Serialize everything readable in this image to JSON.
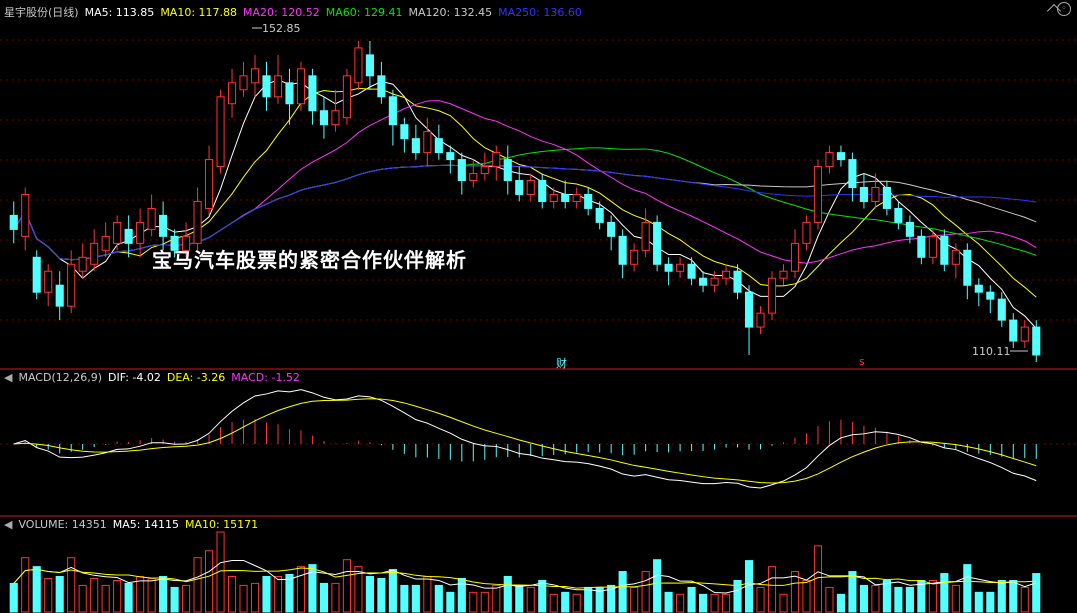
{
  "header": {
    "title": "星宇股份(日线)",
    "ma5": "MA5: 113.85",
    "ma10": "MA10: 117.88",
    "ma20": "MA20: 120.52",
    "ma60": "MA60: 129.41",
    "ma120": "MA120: 132.45",
    "ma250": "MA250: 136.60"
  },
  "overlay_text": "宝马汽车股票的紧密合作伙伴解析",
  "markers": {
    "high_label": "152.85",
    "low_label": "110.11",
    "fin_badge": "财",
    "s_badge": "s"
  },
  "macd_legend": {
    "name": "MACD(12,26,9)",
    "dif": "DIF: -4.02",
    "dea": "DEA: -3.26",
    "macd": "MACD: -1.52"
  },
  "volume_legend": {
    "name": "VOLUME: 14351",
    "ma5": "MA5: 14115",
    "ma10": "MA10: 15171"
  },
  "colors": {
    "up": "#ff3232",
    "down": "#54ffff",
    "ma5": "#ffffff",
    "ma10": "#ffff00",
    "ma20": "#ff32ff",
    "ma60": "#00e600",
    "ma120": "#c8c8c8",
    "ma250": "#3232ff",
    "divider": "#c81e1e"
  },
  "chart_data": [
    {
      "type": "candlestick",
      "title": "星宇股份(日线)",
      "ylim": [
        108,
        156
      ],
      "candles": [
        [
          128,
          126,
          130,
          124
        ],
        [
          125,
          131,
          132,
          123
        ],
        [
          122,
          117,
          123,
          116
        ],
        [
          117,
          120,
          121,
          115
        ],
        [
          118,
          115,
          120,
          113
        ],
        [
          115,
          121,
          123,
          114
        ],
        [
          120,
          122,
          124,
          119
        ],
        [
          121,
          124,
          126,
          120
        ],
        [
          123,
          125,
          127,
          122
        ],
        [
          124,
          127,
          128,
          123
        ],
        [
          126,
          124,
          128,
          122
        ],
        [
          124,
          127,
          129,
          122
        ],
        [
          126,
          129,
          131,
          125
        ],
        [
          128,
          125,
          130,
          123
        ],
        [
          125,
          123,
          126,
          122
        ],
        [
          123,
          125,
          127,
          122
        ],
        [
          124,
          130,
          132,
          123
        ],
        [
          129,
          136,
          138,
          128
        ],
        [
          135,
          145,
          146,
          134
        ],
        [
          144,
          147,
          149,
          142
        ],
        [
          146,
          148,
          150,
          145
        ],
        [
          147,
          149,
          151,
          145
        ],
        [
          148,
          145,
          150,
          143
        ],
        [
          145,
          148,
          151,
          144
        ],
        [
          147,
          144,
          149,
          141
        ],
        [
          144,
          149,
          150,
          143
        ],
        [
          148,
          143,
          149,
          141
        ],
        [
          143,
          141,
          145,
          139
        ],
        [
          141,
          143,
          146,
          140
        ],
        [
          142,
          148,
          149,
          141
        ],
        [
          147,
          152,
          153,
          146
        ],
        [
          151,
          148,
          153,
          146
        ],
        [
          148,
          145,
          150,
          144
        ],
        [
          145,
          141,
          146,
          138
        ],
        [
          141,
          139,
          142,
          137
        ],
        [
          139,
          137,
          141,
          136
        ],
        [
          137,
          140,
          142,
          135
        ],
        [
          139,
          137,
          141,
          136
        ],
        [
          137,
          136,
          138,
          134
        ],
        [
          136,
          133,
          137,
          131
        ],
        [
          133,
          134,
          136,
          132
        ],
        [
          134,
          135,
          137,
          133
        ],
        [
          135,
          137,
          138,
          133
        ],
        [
          136,
          133,
          138,
          131
        ],
        [
          133,
          131,
          135,
          130
        ],
        [
          131,
          133,
          134,
          130
        ],
        [
          133,
          130,
          134,
          129
        ],
        [
          130,
          131,
          132,
          129
        ],
        [
          131,
          130,
          133,
          129
        ],
        [
          130,
          131,
          132,
          129
        ],
        [
          131,
          129,
          132,
          128
        ],
        [
          129,
          127,
          130,
          126
        ],
        [
          127,
          125,
          128,
          123
        ],
        [
          125,
          121,
          126,
          119
        ],
        [
          121,
          123,
          124,
          120
        ],
        [
          123,
          127,
          129,
          122
        ],
        [
          127,
          121,
          128,
          120
        ],
        [
          121,
          120,
          122,
          118
        ],
        [
          120,
          121,
          122,
          119
        ],
        [
          121,
          119,
          122,
          118
        ],
        [
          119,
          118,
          120,
          117
        ],
        [
          118,
          119,
          120,
          117
        ],
        [
          119,
          120,
          121,
          118
        ],
        [
          120,
          117,
          121,
          116
        ],
        [
          117,
          112,
          118,
          108
        ],
        [
          112,
          114,
          115,
          111
        ],
        [
          114,
          119,
          120,
          113
        ],
        [
          119,
          120,
          121,
          118
        ],
        [
          120,
          124,
          126,
          119
        ],
        [
          124,
          127,
          128,
          123
        ],
        [
          127,
          135,
          136,
          126
        ],
        [
          135,
          137,
          138,
          134
        ],
        [
          137,
          136,
          138,
          135
        ],
        [
          136,
          132,
          137,
          130
        ],
        [
          132,
          130,
          134,
          129
        ],
        [
          130,
          132,
          134,
          129
        ],
        [
          132,
          129,
          133,
          128
        ],
        [
          129,
          127,
          130,
          126
        ],
        [
          127,
          125,
          128,
          124
        ],
        [
          125,
          122,
          126,
          121
        ],
        [
          122,
          125,
          126,
          121
        ],
        [
          125,
          121,
          126,
          120
        ],
        [
          121,
          123,
          124,
          119
        ],
        [
          123,
          118,
          124,
          116
        ],
        [
          118,
          117,
          119,
          115
        ],
        [
          117,
          116,
          118,
          114
        ],
        [
          116,
          113,
          117,
          112
        ],
        [
          113,
          110,
          114,
          109
        ],
        [
          110,
          112,
          113,
          109
        ],
        [
          112,
          108,
          113,
          107
        ]
      ]
    },
    {
      "type": "line",
      "title": "MACD(12,26,9)",
      "series_names": [
        "DIF",
        "DEA",
        "MACD"
      ],
      "last": {
        "DIF": -4.02,
        "DEA": -3.26,
        "MACD": -1.52
      }
    },
    {
      "type": "bar",
      "title": "VOLUME",
      "last": {
        "VOLUME": 14351,
        "MA5": 14115,
        "MA10": 15171
      }
    }
  ]
}
